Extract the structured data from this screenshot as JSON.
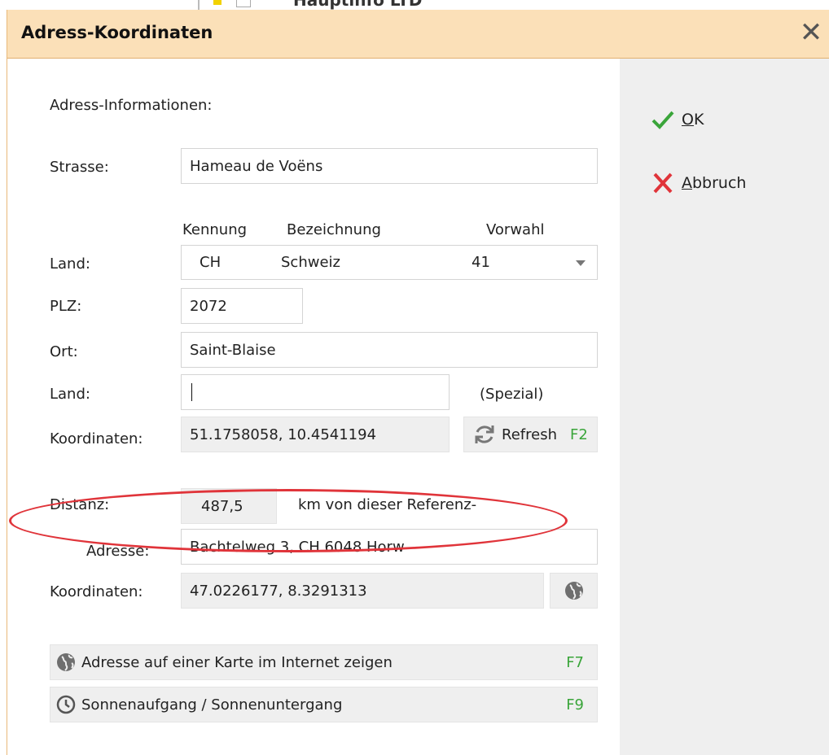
{
  "dialog": {
    "title": "Adress-Koordinaten"
  },
  "actions": {
    "ok": "K",
    "ok_mnemonic": "O",
    "cancel": "bbruch",
    "cancel_mnemonic": "A"
  },
  "form": {
    "section_label": "Adress-Informationen:",
    "strasse_label": "Strasse:",
    "strasse_value": "Hameau de Voëns",
    "col_kennung": "Kennung",
    "col_bezeichnung": "Bezeichnung",
    "col_vorwahl": "Vorwahl",
    "land_label": "Land:",
    "land_code": "CH",
    "land_name": "Schweiz",
    "land_vorwahl": "41",
    "plz_label": "PLZ:",
    "plz_value": "2072",
    "ort_label": "Ort:",
    "ort_value": "Saint-Blaise",
    "land2_label": "Land:",
    "land2_value": "",
    "spezial_label": "(Spezial)",
    "koord_label": "Koordinaten:",
    "koord_value": "51.1758058, 10.4541194",
    "refresh_label": "Refresh",
    "refresh_key": "F2",
    "distanz_label": "Distanz:",
    "distanz_value": "487,5",
    "distanz_suffix": "km von dieser Referenz-",
    "adresse_label": "Adresse:",
    "adresse_value": "Bachtelweg 3, CH 6048 Horw",
    "koord2_label": "Koordinaten:",
    "koord2_value": "47.0226177, 8.3291313",
    "map_label": "Adresse auf einer Karte im Internet zeigen",
    "map_key": "F7",
    "sun_label": "Sonnenaufgang / Sonnenuntergang",
    "sun_key": "F9"
  },
  "background": {
    "partial_text": "Hauptinfo LTD"
  },
  "colors": {
    "title_bg": "#fbe0b8",
    "sidebar_bg": "#efefef",
    "ok_green": "#3aa53a",
    "cancel_red": "#e0343a",
    "highlight_ellipse": "#e0343a"
  },
  "icons": [
    "close-icon",
    "checkmark-icon",
    "x-icon",
    "refresh-icon",
    "globe-icon",
    "clock-icon"
  ]
}
